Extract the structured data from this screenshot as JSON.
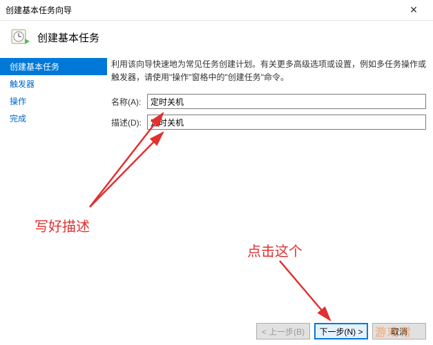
{
  "window": {
    "title": "创建基本任务向导"
  },
  "header": {
    "title": "创建基本任务"
  },
  "sidebar": {
    "steps": [
      "创建基本任务",
      "触发器",
      "操作",
      "完成"
    ]
  },
  "main": {
    "intro": "利用该向导快速地为常见任务创建计划。有关更多高级选项或设置，例如多任务操作或触发器，请使用\"操作\"窗格中的\"创建任务\"命令。",
    "name_label": "名称(A):",
    "name_value": "定时关机",
    "desc_label": "描述(D):",
    "desc_value": "定时关机"
  },
  "footer": {
    "back": "< 上一步(B)",
    "next": "下一步(N) >",
    "cancel": "取消"
  },
  "annotations": {
    "left": "写好描述",
    "right": "点击这个"
  },
  "watermark": "游戏常"
}
